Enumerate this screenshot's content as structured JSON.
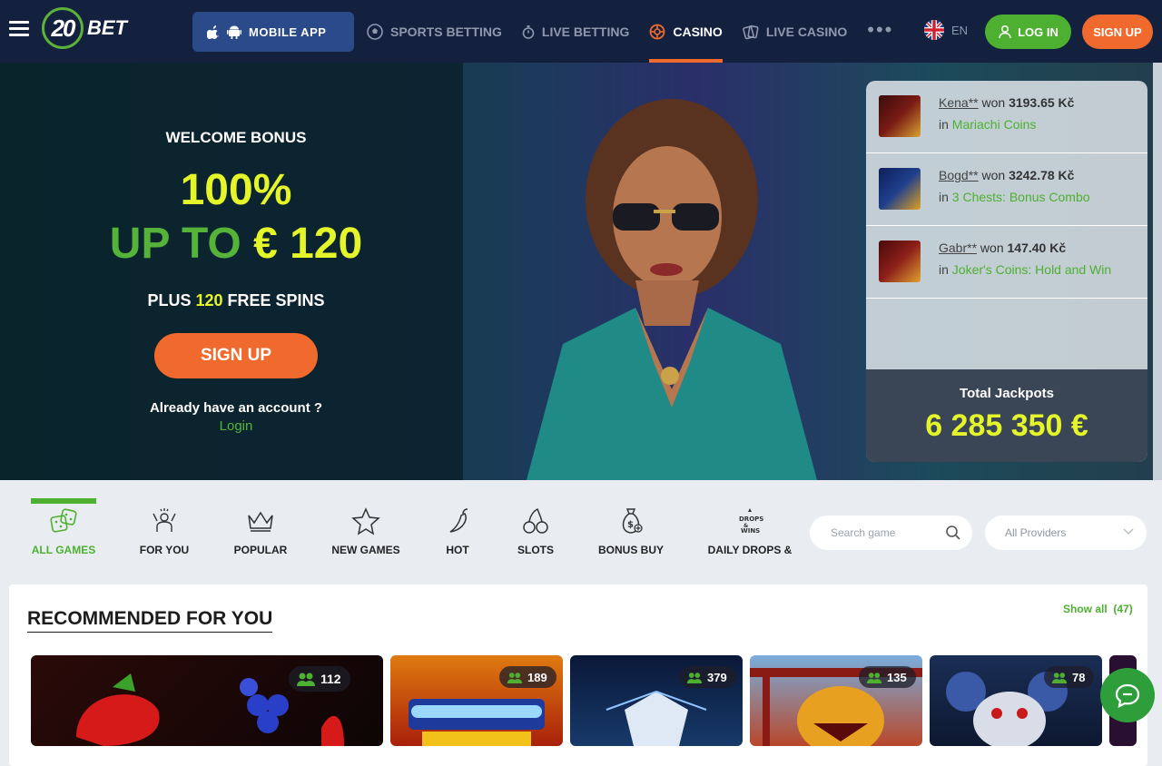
{
  "header": {
    "logo_number": "20",
    "logo_text": "BET",
    "mobile_app": "MOBILE APP",
    "nav": [
      {
        "label": "SPORTS BETTING",
        "icon": "soccer-ball-icon"
      },
      {
        "label": "LIVE BETTING",
        "icon": "stopwatch-icon"
      },
      {
        "label": "CASINO",
        "icon": "roulette-icon",
        "active": true
      },
      {
        "label": "LIVE CASINO",
        "icon": "cards-icon"
      }
    ],
    "more": "•••",
    "lang": "EN",
    "login": "LOG IN",
    "signup": "SIGN UP"
  },
  "hero": {
    "title": "WELCOME BONUS",
    "percent": "100%",
    "up_to": "UP TO",
    "amount": "€ 120",
    "plus": "PLUS",
    "spins_num": "120",
    "spins_text": "FREE SPINS",
    "signup": "SIGN UP",
    "already": "Already have an account ?",
    "login": "Login"
  },
  "winners": [
    {
      "user": "Kena**",
      "won": "won",
      "amount": "3193.65 Kč",
      "in": "in",
      "game": "Mariachi Coins",
      "thumb": "#7a1a14"
    },
    {
      "user": "Bogd**",
      "won": "won",
      "amount": "3242.78 Kč",
      "in": "in",
      "game": "3 Chests: Bonus Combo",
      "thumb": "#1f3f8c"
    },
    {
      "user": "Gabr**",
      "won": "won",
      "amount": "147.40 Kč",
      "in": "in",
      "game": "Joker's Coins: Hold and Win",
      "thumb": "#8c1f1a"
    }
  ],
  "jackpot": {
    "label": "Total Jackpots",
    "value": "6 285 350 €"
  },
  "categories": [
    {
      "label": "ALL GAMES",
      "icon": "dice-icon",
      "active": true
    },
    {
      "label": "FOR YOU",
      "icon": "person-cheer-icon"
    },
    {
      "label": "POPULAR",
      "icon": "crown-icon"
    },
    {
      "label": "NEW GAMES",
      "icon": "star-icon"
    },
    {
      "label": "HOT",
      "icon": "chili-pepper-icon"
    },
    {
      "label": "SLOTS",
      "icon": "cherries-icon"
    },
    {
      "label": "BONUS BUY",
      "icon": "money-bag-icon"
    },
    {
      "label": "DAILY DROPS &",
      "icon": "drops-wins-icon"
    }
  ],
  "search": {
    "placeholder": "Search game"
  },
  "providers": {
    "value": "All Providers"
  },
  "recommended": {
    "title": "RECOMMENDED FOR YOU",
    "show_all": "Show all",
    "count": "(47)",
    "cards": [
      {
        "players": "112",
        "bg": "#1a0c0c"
      },
      {
        "players": "189",
        "bg": "#c2420e"
      },
      {
        "players": "379",
        "bg": "#0e1d3a"
      },
      {
        "players": "135",
        "bg": "#6a9cc8"
      },
      {
        "players": "78",
        "bg": "#162a4a"
      }
    ]
  }
}
